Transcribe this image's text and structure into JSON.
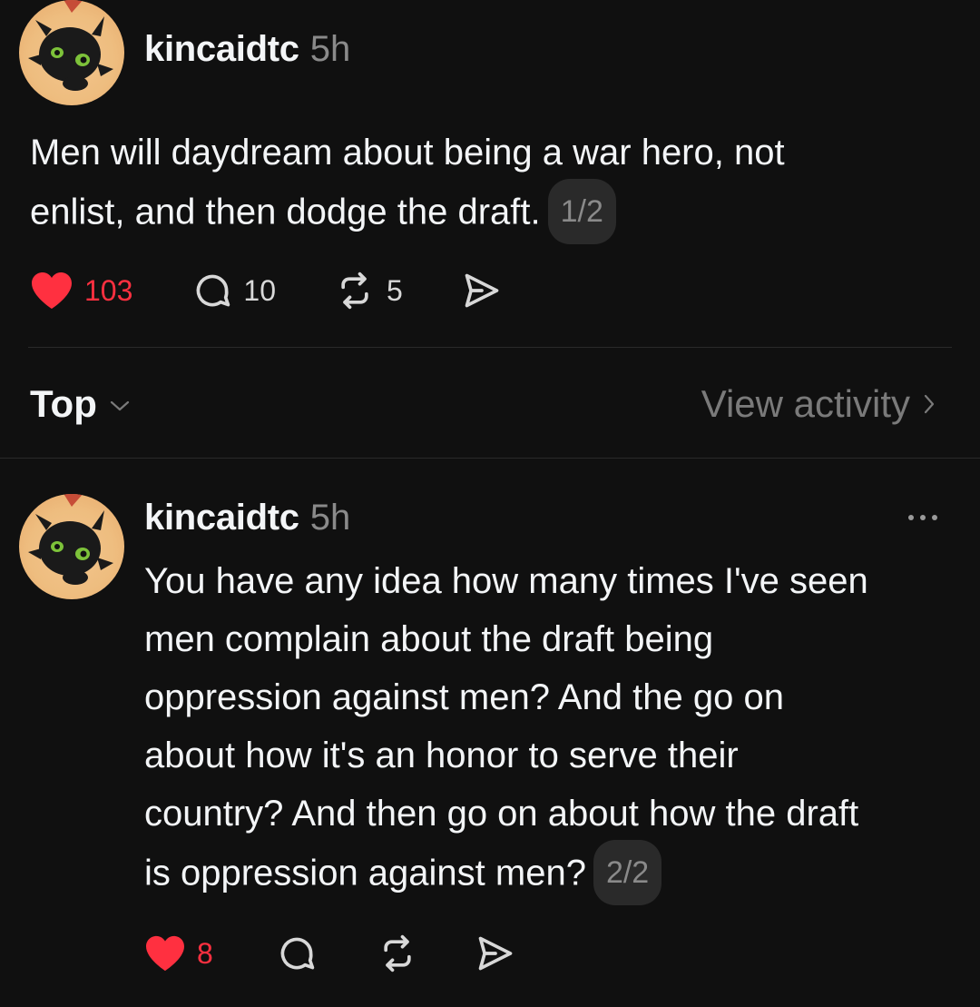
{
  "main_post": {
    "username": "kincaidtc",
    "time": "5h",
    "text_line1": "Men will daydream about being a war hero, not",
    "text_line2": "enlist, and then dodge the draft.",
    "thread_index": "1/2",
    "likes": "103",
    "replies": "10",
    "reposts": "5"
  },
  "sort_bar": {
    "sort_label": "Top",
    "view_activity": "View activity"
  },
  "reply_post": {
    "username": "kincaidtc",
    "time": "5h",
    "lines": [
      "You have any idea how many times I've seen",
      "men complain about the draft being",
      "oppression against men? And the go on",
      "about how it's an honor to serve their",
      "country? And then go on about how the draft",
      "is oppression against men?"
    ],
    "thread_index": "2/2",
    "likes": "8"
  },
  "colors": {
    "background": "#101010",
    "like_red": "#ff3040",
    "muted": "#8a8a8a"
  },
  "icons": [
    "heart-icon",
    "comment-icon",
    "repost-icon",
    "share-icon",
    "chevron-down-icon",
    "chevron-right-icon",
    "more-icon"
  ]
}
